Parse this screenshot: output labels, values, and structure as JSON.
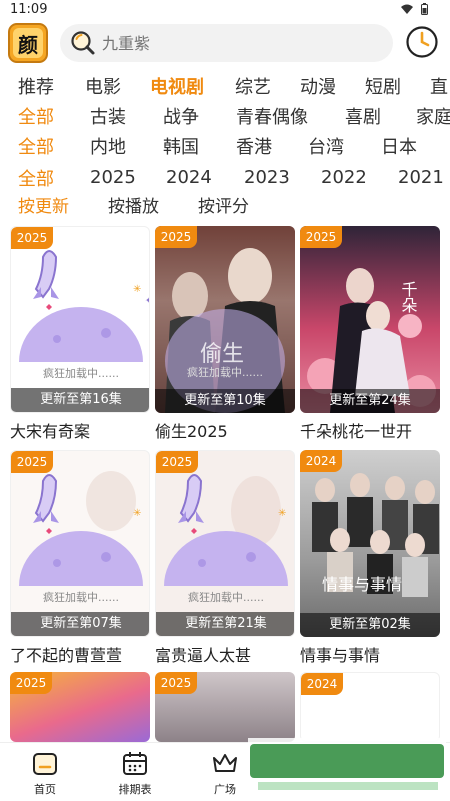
{
  "status": {
    "time": "11:09"
  },
  "app": {
    "logo_char": "颜"
  },
  "search": {
    "placeholder": "九重紫"
  },
  "rows": {
    "type": [
      "推荐",
      "电影",
      "电视剧",
      "综艺",
      "动漫",
      "短剧",
      "直"
    ],
    "genre": [
      "全部",
      "古装",
      "战争",
      "青春偶像",
      "喜剧",
      "家庭"
    ],
    "region": [
      "全部",
      "内地",
      "韩国",
      "香港",
      "台湾",
      "日本"
    ],
    "year": [
      "全部",
      "2025",
      "2024",
      "2023",
      "2022",
      "2021"
    ]
  },
  "sort": [
    "按更新",
    "按播放",
    "按评分"
  ],
  "cards": [
    {
      "year": "2025",
      "update": "更新至第16集",
      "title": "大宋有奇案",
      "loading": "疯狂加载中......"
    },
    {
      "year": "2025",
      "update": "更新至第10集",
      "title": "偷生2025",
      "loading": "疯狂加载中......"
    },
    {
      "year": "2025",
      "update": "更新至第24集",
      "title": "千朵桃花一世开"
    },
    {
      "year": "2025",
      "update": "更新至第07集",
      "title": "了不起的曹萱萱",
      "loading": "疯狂加载中......"
    },
    {
      "year": "2025",
      "update": "更新至第21集",
      "title": "富贵逼人太甚",
      "loading": "疯狂加载中......"
    },
    {
      "year": "2024",
      "update": "更新至第02集",
      "title": "情事与事情"
    },
    {
      "year": "2025"
    },
    {
      "year": "2025"
    },
    {
      "year": "2024"
    }
  ],
  "tabs": [
    "首页",
    "排期表",
    "广场",
    "",
    ""
  ],
  "colors": {
    "accent": "#f08a10"
  }
}
